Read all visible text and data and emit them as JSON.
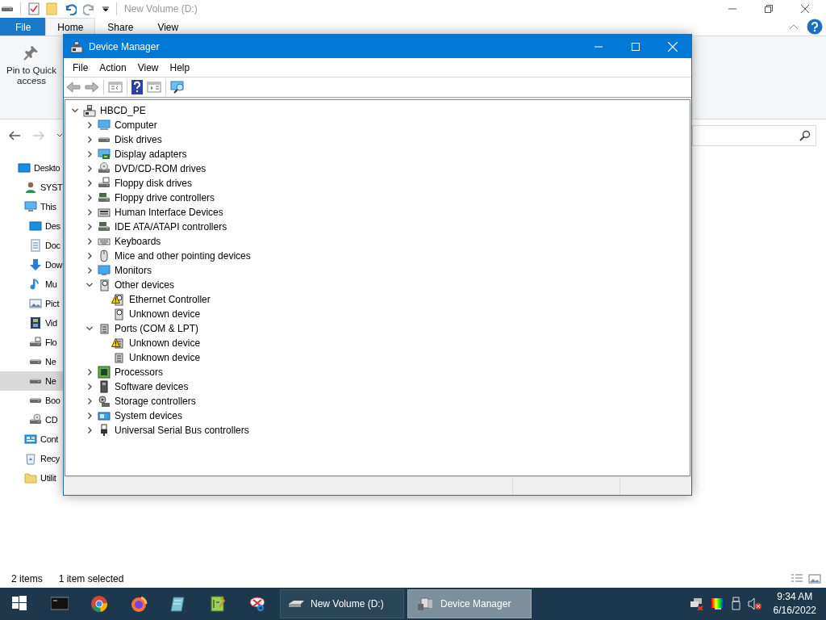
{
  "explorer": {
    "title": "New Volume (D:)",
    "ribbon_tabs": [
      {
        "label": "File",
        "kind": "file",
        "selected": false
      },
      {
        "label": "Home",
        "kind": "tab",
        "selected": true
      },
      {
        "label": "Share",
        "kind": "tab",
        "selected": false
      },
      {
        "label": "View",
        "kind": "tab",
        "selected": false
      }
    ],
    "ribbon_commands": [
      {
        "label": "Pin to Quick access",
        "kind": "pin"
      }
    ],
    "nav_pane": [
      {
        "label": "Deskto",
        "kind": "desktop",
        "selected": false,
        "children": [
          {
            "label": "SYST",
            "kind": "user",
            "selected": false
          },
          {
            "label": "This",
            "kind": "pc",
            "selected": false,
            "children": [
              {
                "label": "Des",
                "kind": "desktop",
                "selected": false
              },
              {
                "label": "Doc",
                "kind": "documents",
                "selected": false
              },
              {
                "label": "Dow",
                "kind": "downloads",
                "selected": false
              },
              {
                "label": "Mu",
                "kind": "music",
                "selected": false
              },
              {
                "label": "Pict",
                "kind": "pictures",
                "selected": false
              },
              {
                "label": "Vid",
                "kind": "videos",
                "selected": false
              },
              {
                "label": "Flo",
                "kind": "floppy",
                "selected": false
              },
              {
                "label": "Ne",
                "kind": "drive",
                "selected": false
              },
              {
                "label": "Ne",
                "kind": "drive",
                "selected": true
              },
              {
                "label": "Boo",
                "kind": "drive",
                "selected": false
              },
              {
                "label": "CD",
                "kind": "cd",
                "selected": false
              }
            ]
          },
          {
            "label": "Cont",
            "kind": "control",
            "selected": false
          },
          {
            "label": "Recy",
            "kind": "recycle",
            "selected": false
          },
          {
            "label": "Utilit",
            "kind": "folder",
            "selected": false
          }
        ]
      }
    ],
    "status_bar": [
      "2 items",
      "1 item selected"
    ]
  },
  "device_manager": {
    "title": "Device Manager",
    "menu": [
      "File",
      "Action",
      "View",
      "Help"
    ],
    "tree": {
      "label": "HBCD_PE",
      "kind": "root",
      "expanded": true,
      "children": [
        {
          "label": "Computer",
          "kind": "computer",
          "expanded": false
        },
        {
          "label": "Disk drives",
          "kind": "disk",
          "expanded": false
        },
        {
          "label": "Display adapters",
          "kind": "display",
          "expanded": false
        },
        {
          "label": "DVD/CD-ROM drives",
          "kind": "dvd",
          "expanded": false
        },
        {
          "label": "Floppy disk drives",
          "kind": "floppy",
          "expanded": false
        },
        {
          "label": "Floppy drive controllers",
          "kind": "controller",
          "expanded": false
        },
        {
          "label": "Human Interface Devices",
          "kind": "hid",
          "expanded": false
        },
        {
          "label": "IDE ATA/ATAPI controllers",
          "kind": "controller",
          "expanded": false
        },
        {
          "label": "Keyboards",
          "kind": "keyboard",
          "expanded": false
        },
        {
          "label": "Mice and other pointing devices",
          "kind": "mouse",
          "expanded": false
        },
        {
          "label": "Monitors",
          "kind": "monitor",
          "expanded": false
        },
        {
          "label": "Other devices",
          "kind": "other",
          "expanded": true,
          "children": [
            {
              "label": "Ethernet Controller",
              "kind": "other",
              "warning": true
            },
            {
              "label": "Unknown device",
              "kind": "other",
              "warning": false
            }
          ]
        },
        {
          "label": "Ports (COM & LPT)",
          "kind": "port",
          "expanded": true,
          "children": [
            {
              "label": "Unknown device",
              "kind": "port",
              "warning": true
            },
            {
              "label": "Unknown device",
              "kind": "port",
              "warning": false
            }
          ]
        },
        {
          "label": "Processors",
          "kind": "cpu",
          "expanded": false
        },
        {
          "label": "Software devices",
          "kind": "software",
          "expanded": false
        },
        {
          "label": "Storage controllers",
          "kind": "storage",
          "expanded": false
        },
        {
          "label": "System devices",
          "kind": "system",
          "expanded": false
        },
        {
          "label": "Universal Serial Bus controllers",
          "kind": "usb",
          "expanded": false
        }
      ]
    }
  },
  "taskbar": {
    "tasks": [
      {
        "label": "New Volume (D:)",
        "kind": "drive",
        "selected": false
      },
      {
        "label": "Device Manager",
        "kind": "devmgr",
        "selected": true
      }
    ],
    "clock": {
      "time": "9:34 AM",
      "date": "6/16/2022"
    }
  }
}
